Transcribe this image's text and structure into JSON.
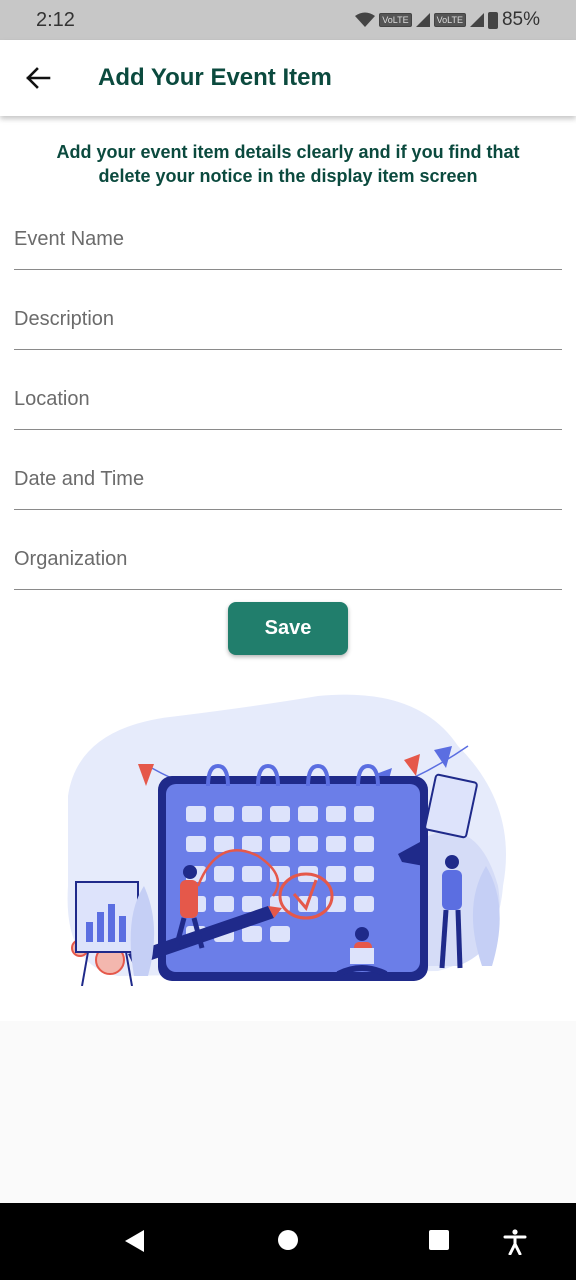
{
  "status_bar": {
    "time": "2:12",
    "lte1": "VoLTE",
    "lte2": "VoLTE",
    "battery": "85%"
  },
  "app_bar": {
    "title": "Add Your Event Item",
    "back_icon": "arrow-left-icon"
  },
  "intro_text": "Add your event item details clearly and if you find that delete your notice in the display item screen",
  "form": {
    "fields": [
      {
        "placeholder": "Event Name",
        "value": ""
      },
      {
        "placeholder": "Description",
        "value": ""
      },
      {
        "placeholder": "Location",
        "value": ""
      },
      {
        "placeholder": "Date and Time",
        "value": ""
      },
      {
        "placeholder": "Organization",
        "value": ""
      }
    ],
    "save_label": "Save"
  },
  "colors": {
    "accent": "#217e6c",
    "title": "#0b4a3e",
    "illustration_blue": "#5b6ee1",
    "illustration_red": "#e5584a"
  },
  "nav": {
    "back_icon": "triangle-back-icon",
    "home_icon": "circle-home-icon",
    "recents_icon": "square-recents-icon",
    "accessibility_icon": "accessibility-icon"
  }
}
